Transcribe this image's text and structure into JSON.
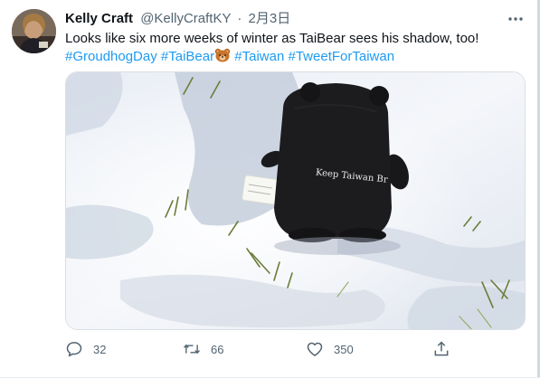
{
  "tweet": {
    "author_name": "Kelly Craft",
    "author_handle": "@KellyCraftKY",
    "separator": "·",
    "timestamp": "2月3日",
    "text_main": "Looks like six more weeks of winter as TaiBear sees his shadow, too!",
    "hashtags": [
      "#GroudhogDay",
      "#TaiBear",
      "#Taiwan",
      "#TweetForTaiwan"
    ],
    "bear_emoji": "bear-face",
    "image_text": "Keep Taiwan Br"
  },
  "actions": {
    "reply_count": "32",
    "retweet_count": "66",
    "like_count": "350"
  },
  "colors": {
    "link": "#1d9bf0",
    "secondary_text": "#536471",
    "primary_text": "#0f1419"
  },
  "icons": [
    "avatar",
    "more-icon",
    "bear-emoji-icon",
    "reply-icon",
    "retweet-icon",
    "like-icon",
    "share-icon"
  ]
}
